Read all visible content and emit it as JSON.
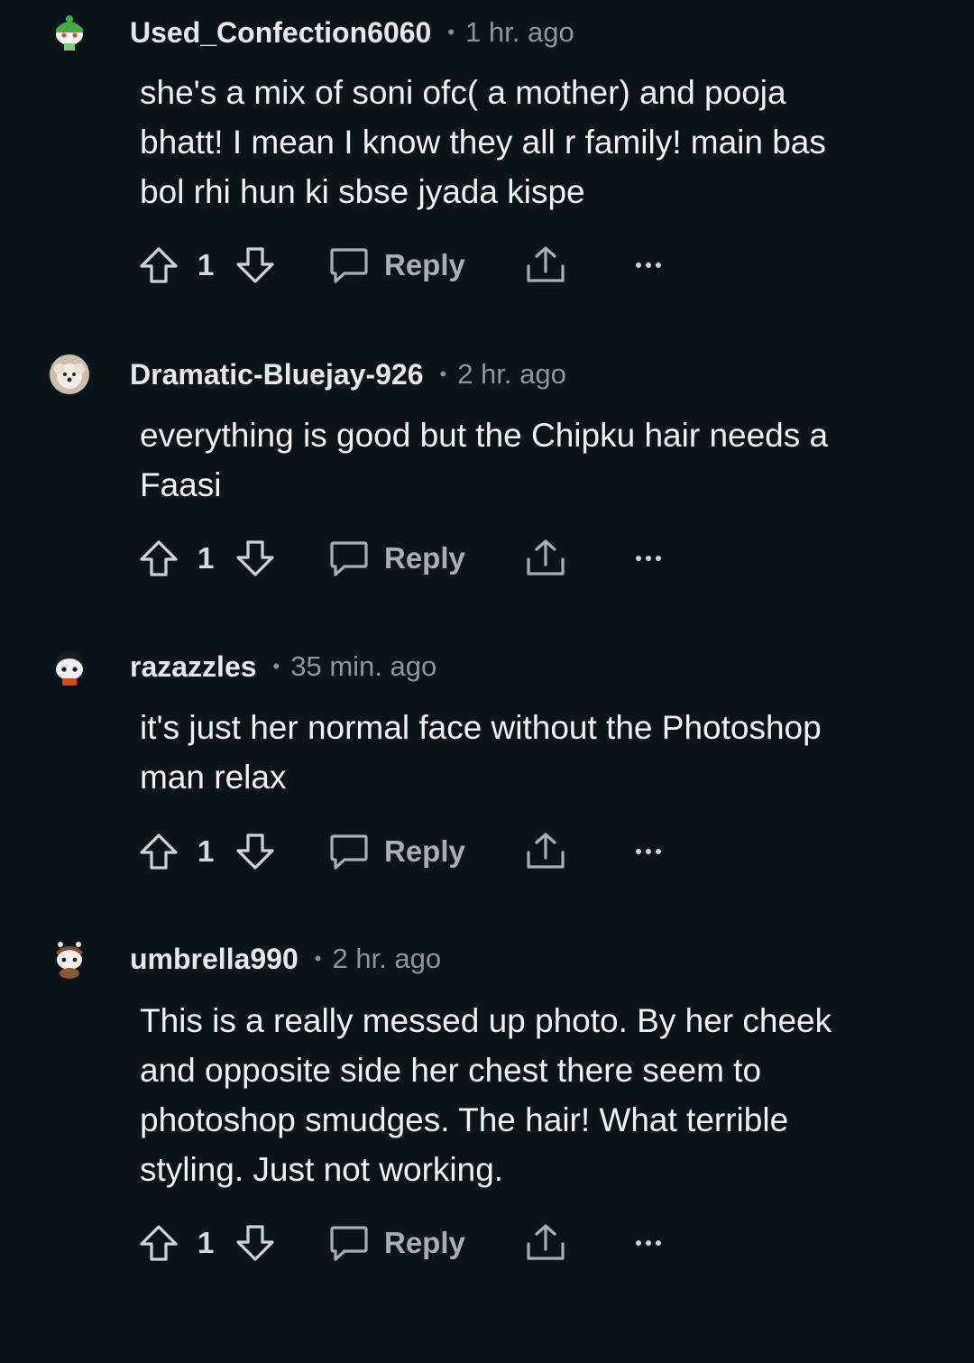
{
  "comments": [
    {
      "username": "Used_Confection6060",
      "time": "1 hr. ago",
      "body_lines": [
        "she's a mix of soni ofc( a mother) and pooja",
        "bhatt! I mean I know they all r family! main bas",
        "bol rhi hun ki sbse jyada kispe"
      ],
      "votes": "1",
      "reply_label": "Reply",
      "avatar_icon": "snoo-green-hat-avatar-icon"
    },
    {
      "username": "Dramatic-Bluejay-926",
      "time": "2 hr. ago",
      "body_lines": [
        "everything is good but the Chipku hair needs a",
        "Faasi"
      ],
      "votes": "1",
      "reply_label": "Reply",
      "avatar_icon": "white-dog-avatar-icon"
    },
    {
      "username": "razazzles",
      "time": "35 min. ago",
      "body_lines": [
        "it's just her normal face without the Photoshop",
        "man relax"
      ],
      "votes": "1",
      "reply_label": "Reply",
      "avatar_icon": "snoo-dark-hair-avatar-icon"
    },
    {
      "username": "umbrella990",
      "time": "2 hr. ago",
      "body_lines": [
        "This is a really messed up photo. By her cheek",
        "and opposite side her chest there seem to",
        "photoshop smudges. The hair! What terrible",
        "styling. Just not working."
      ],
      "votes": "1",
      "reply_label": "Reply",
      "avatar_icon": "snoo-brown-avatar-icon"
    }
  ],
  "colors": {
    "background": "#0c1418",
    "text": "#f0f2f3",
    "muted": "#8f969a"
  }
}
